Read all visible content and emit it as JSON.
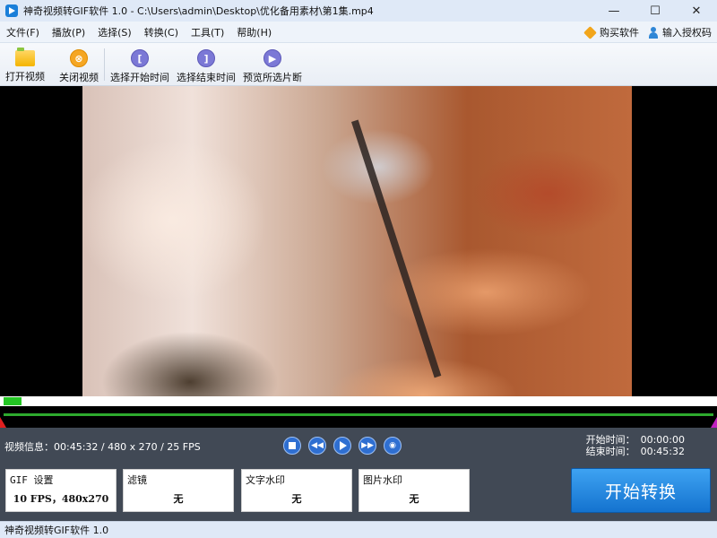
{
  "window": {
    "title": "神奇视频转GIF软件 1.0 - C:\\Users\\admin\\Desktop\\优化备用素材\\第1集.mp4",
    "buttons": {
      "minimize": "—",
      "maximize": "☐",
      "close": "✕"
    }
  },
  "menu": {
    "items": [
      "文件(F)",
      "播放(P)",
      "选择(S)",
      "转换(C)",
      "工具(T)",
      "帮助(H)"
    ],
    "buy": "购买软件",
    "license": "输入授权码"
  },
  "toolbar": {
    "open": "打开视频",
    "close": "关闭视频",
    "select_start": "选择开始时间",
    "select_end": "选择结束时间",
    "preview": "预览所选片断",
    "glyph_start": "[",
    "glyph_end": "]",
    "glyph_preview": "▶"
  },
  "playback": {
    "progress": 0.025
  },
  "info": {
    "video_info": "视频信息：00:45:32 / 480 x 270 / 25 FPS"
  },
  "times": {
    "start_label": "开始时间：",
    "start_value": "00:00:00",
    "end_label": "结束时间：",
    "end_value": "00:45:32"
  },
  "cards": {
    "gif": {
      "title": "GIF 设置",
      "value": "10 FPS，480x270"
    },
    "filter": {
      "title": "滤镜",
      "value": "无"
    },
    "text_watermark": {
      "title": "文字水印",
      "value": "无"
    },
    "image_watermark": {
      "title": "图片水印",
      "value": "无"
    }
  },
  "actions": {
    "start_convert": "开始转换"
  },
  "status": {
    "text": "神奇视频转GIF软件 1.0"
  },
  "colors": {
    "accent": "#1a7fd9",
    "progress": "#24c624",
    "panel": "#414955"
  }
}
